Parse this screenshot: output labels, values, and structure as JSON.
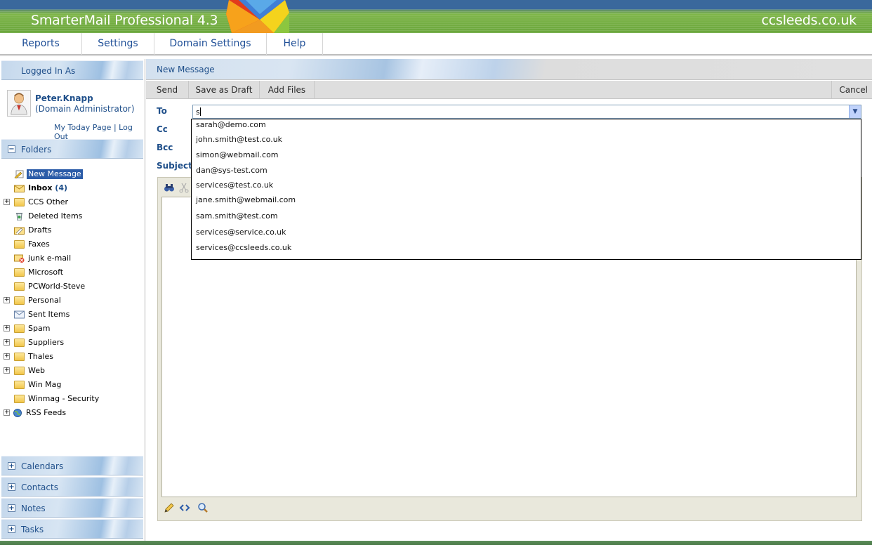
{
  "header": {
    "app_title": "SmarterMail Professional 4.3",
    "domain": "ccsleeds.co.uk",
    "logo_icon": "envelope-logo-icon"
  },
  "topmenu": {
    "items": [
      {
        "label": "Reports"
      },
      {
        "label": "Settings"
      },
      {
        "label": "Domain Settings"
      },
      {
        "label": "Help"
      }
    ]
  },
  "sidebar": {
    "logged_in_title": "Logged In As",
    "user_name": "Peter.Knapp",
    "user_role": "(Domain Administrator)",
    "my_today_page": "My Today Page",
    "separator": "|",
    "log_out": "Log Out",
    "folders_title": "Folders",
    "folders_toggle": "−",
    "folders": [
      {
        "label": "New Message",
        "icon": "new-message-icon",
        "expand": false
      },
      {
        "label": "Inbox",
        "count": "(4)",
        "icon": "inbox-icon",
        "expand": false
      },
      {
        "label": "CCS Other",
        "icon": "folder-icon",
        "expand": true
      },
      {
        "label": "Deleted Items",
        "icon": "trash-icon",
        "expand": false
      },
      {
        "label": "Drafts",
        "icon": "drafts-icon",
        "expand": false
      },
      {
        "label": "Faxes",
        "icon": "folder-icon",
        "expand": false
      },
      {
        "label": "junk e-mail",
        "icon": "junk-icon",
        "expand": false
      },
      {
        "label": "Microsoft",
        "icon": "folder-icon",
        "expand": false
      },
      {
        "label": "PCWorld-Steve",
        "icon": "folder-icon",
        "expand": false
      },
      {
        "label": "Personal",
        "icon": "folder-icon",
        "expand": true
      },
      {
        "label": "Sent Items",
        "icon": "sent-icon",
        "expand": false
      },
      {
        "label": "Spam",
        "icon": "folder-icon",
        "expand": true
      },
      {
        "label": "Suppliers",
        "icon": "folder-icon",
        "expand": true
      },
      {
        "label": "Thales",
        "icon": "folder-icon",
        "expand": true
      },
      {
        "label": "Web",
        "icon": "folder-icon",
        "expand": true
      },
      {
        "label": "Win Mag",
        "icon": "folder-icon",
        "expand": false
      },
      {
        "label": "Winmag - Security",
        "icon": "folder-icon",
        "expand": false
      },
      {
        "label": "RSS Feeds",
        "icon": "rss-globe-icon",
        "expand": true
      }
    ],
    "bottom_panels": [
      {
        "label": "Calendars",
        "toggle": "+"
      },
      {
        "label": "Contacts",
        "toggle": "+"
      },
      {
        "label": "Notes",
        "toggle": "+"
      },
      {
        "label": "Tasks",
        "toggle": "+"
      }
    ]
  },
  "main": {
    "title": "New Message",
    "toolbar": {
      "send": "Send",
      "save_draft": "Save as Draft",
      "add_files": "Add Files",
      "cancel": "Cancel"
    },
    "fields": {
      "to_label": "To",
      "cc_label": "Cc",
      "bcc_label": "Bcc",
      "subject_label": "Subject",
      "to_value": "s"
    },
    "autocomplete": [
      "sarah@demo.com",
      "john.smith@test.co.uk",
      "simon@webmail.com",
      "dan@sys-test.com",
      "services@test.co.uk",
      "jane.smith@webmail.com",
      "sam.smith@test.com",
      "services@service.co.uk",
      "services@ccsleeds.co.uk"
    ]
  }
}
